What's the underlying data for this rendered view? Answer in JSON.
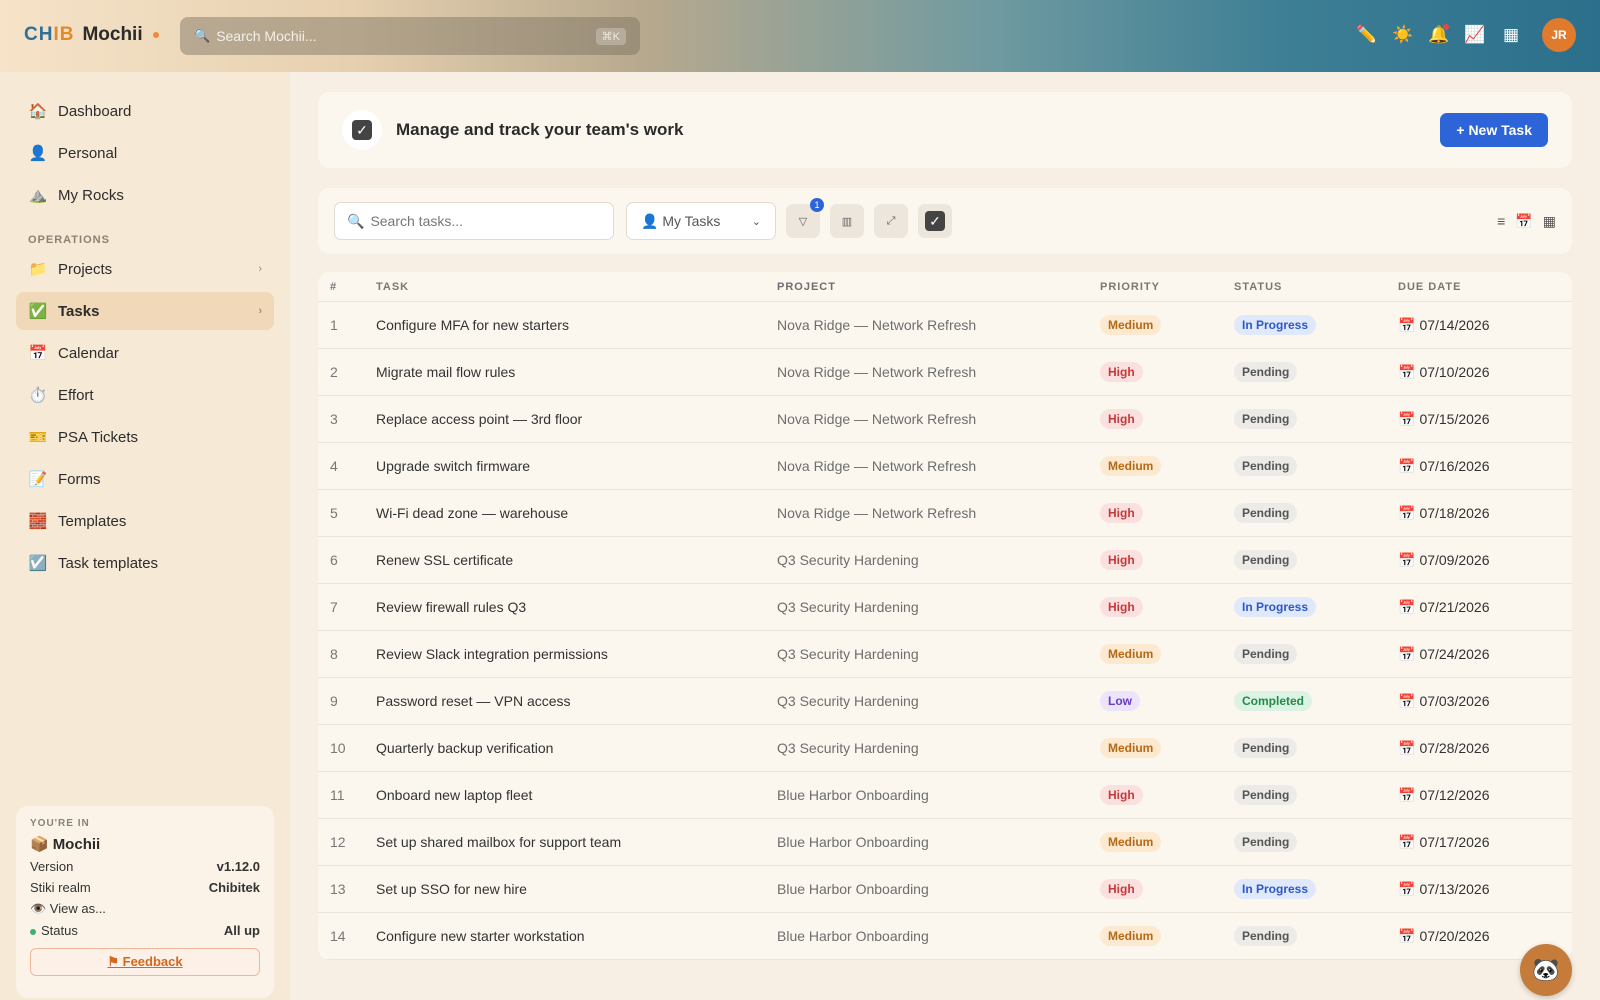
{
  "brand": {
    "logo_a": "CH",
    "logo_b": "IB",
    "name": "Mochii"
  },
  "global_search": {
    "placeholder": "Search Mochii...",
    "shortcut": "⌘K"
  },
  "top_icons": {
    "pencil": "✏️",
    "sun": "☀️",
    "bell": "🔔",
    "chart": "📈",
    "grid": "▦"
  },
  "user": {
    "initials": "JR"
  },
  "sidebar": {
    "items": [
      {
        "icon": "🏠",
        "label": "Dashboard"
      },
      {
        "icon": "👤",
        "label": "Personal"
      },
      {
        "icon": "⛰️",
        "label": "My Rocks"
      }
    ],
    "section_label": "OPERATIONS",
    "ops_items": [
      {
        "icon": "📁",
        "label": "Projects",
        "chevron": "›"
      },
      {
        "icon": "✅",
        "label": "Tasks",
        "chevron": "›"
      },
      {
        "icon": "📅",
        "label": "Calendar"
      },
      {
        "icon": "⏱️",
        "label": "Effort"
      },
      {
        "icon": "🎫",
        "label": "PSA Tickets"
      },
      {
        "icon": "📝",
        "label": "Forms"
      },
      {
        "icon": "🧱",
        "label": "Templates"
      },
      {
        "icon": "☑️",
        "label": "Task templates"
      }
    ]
  },
  "info_card": {
    "label": "YOU'RE IN",
    "workspace_icon": "📦",
    "workspace": "Mochii",
    "version_label": "Version",
    "version": "v1.12.0",
    "realm_label": "Stiki realm",
    "realm": "Chibitek",
    "view_as": "👁️ View as...",
    "status_label": "Status",
    "status": "All up",
    "feedback": "⚑ Feedback"
  },
  "header": {
    "title": "Manage and track your team's work",
    "new_task": "+ New Task"
  },
  "toolbar": {
    "search_placeholder": "Search tasks...",
    "filter_select": "👤 My Tasks",
    "filter_badge": "1",
    "buttons": [
      "▽",
      "▥",
      "⤢",
      "✓"
    ]
  },
  "table": {
    "columns": [
      "#",
      "TASK",
      "PROJECT",
      "PRIORITY",
      "STATUS",
      "DUE DATE"
    ],
    "rows": [
      {
        "num": "1",
        "task": "Configure MFA for new starters",
        "project": "Nova Ridge — Network Refresh",
        "priority": "Medium",
        "status": "In Progress",
        "due": "07/14/2026"
      },
      {
        "num": "2",
        "task": "Migrate mail flow rules",
        "project": "Nova Ridge — Network Refresh",
        "priority": "High",
        "status": "Pending",
        "due": "07/10/2026"
      },
      {
        "num": "3",
        "task": "Replace access point — 3rd floor",
        "project": "Nova Ridge — Network Refresh",
        "priority": "High",
        "status": "Pending",
        "due": "07/15/2026"
      },
      {
        "num": "4",
        "task": "Upgrade switch firmware",
        "project": "Nova Ridge — Network Refresh",
        "priority": "Medium",
        "status": "Pending",
        "due": "07/16/2026"
      },
      {
        "num": "5",
        "task": "Wi-Fi dead zone — warehouse",
        "project": "Nova Ridge — Network Refresh",
        "priority": "High",
        "status": "Pending",
        "due": "07/18/2026"
      },
      {
        "num": "6",
        "task": "Renew SSL certificate",
        "project": "Q3 Security Hardening",
        "priority": "High",
        "status": "Pending",
        "due": "07/09/2026"
      },
      {
        "num": "7",
        "task": "Review firewall rules Q3",
        "project": "Q3 Security Hardening",
        "priority": "High",
        "status": "In Progress",
        "due": "07/21/2026"
      },
      {
        "num": "8",
        "task": "Review Slack integration permissions",
        "project": "Q3 Security Hardening",
        "priority": "Medium",
        "status": "Pending",
        "due": "07/24/2026"
      },
      {
        "num": "9",
        "task": "Password reset — VPN access",
        "project": "Q3 Security Hardening",
        "priority": "Low",
        "status": "Completed",
        "due": "07/03/2026"
      },
      {
        "num": "10",
        "task": "Quarterly backup verification",
        "project": "Q3 Security Hardening",
        "priority": "Medium",
        "status": "Pending",
        "due": "07/28/2026"
      },
      {
        "num": "11",
        "task": "Onboard new laptop fleet",
        "project": "Blue Harbor Onboarding",
        "priority": "High",
        "status": "Pending",
        "due": "07/12/2026"
      },
      {
        "num": "12",
        "task": "Set up shared mailbox for support team",
        "project": "Blue Harbor Onboarding",
        "priority": "Medium",
        "status": "Pending",
        "due": "07/17/2026"
      },
      {
        "num": "13",
        "task": "Set up SSO for new hire",
        "project": "Blue Harbor Onboarding",
        "priority": "High",
        "status": "In Progress",
        "due": "07/13/2026"
      },
      {
        "num": "14",
        "task": "Configure new starter workstation",
        "project": "Blue Harbor Onboarding",
        "priority": "Medium",
        "status": "Pending",
        "due": "07/20/2026"
      }
    ]
  },
  "fab_icon": "🐼"
}
